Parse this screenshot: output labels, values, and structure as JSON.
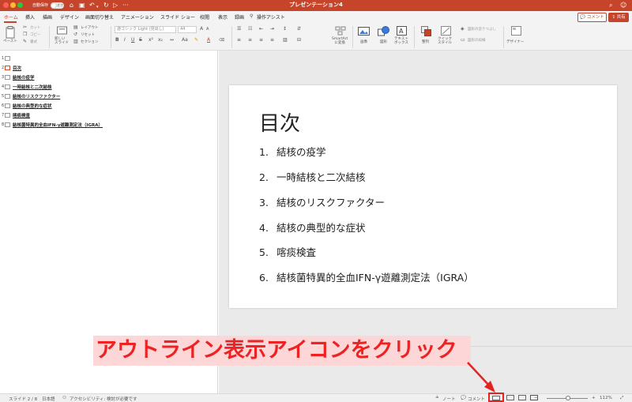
{
  "titlebar": {
    "title": "プレゼンテーション4",
    "autosave_label": "自動保存",
    "autosave_state": "オフ"
  },
  "menu": {
    "tabs": [
      "ホーム",
      "挿入",
      "描画",
      "デザイン",
      "画面切り替え",
      "アニメーション",
      "スライド ショー",
      "校閲",
      "表示",
      "録画",
      "操作アシスト"
    ],
    "active": "ホーム",
    "comment_button": "コメント",
    "share_button": "共有"
  },
  "ribbon": {
    "paste": "ペースト",
    "cut": "カット",
    "copy": "コピー",
    "format": "書式",
    "new_slide": "新しい\nスライド",
    "layout": "レイアウト",
    "reset": "リセット",
    "section": "セクション",
    "font_name": "游ゴシック Light (見出し)",
    "font_size": "44",
    "smartart": "SmartArt\nに変換",
    "picture": "画像",
    "shapes": "図形",
    "textbox": "テキスト\nボックス",
    "arrange": "整列",
    "quick_styles": "クイック\nスタイル",
    "shape_fill": "図形の塗りつぶし",
    "shape_outline": "図形の枠線",
    "designer": "デザイナー"
  },
  "outline": {
    "rows": [
      {
        "num": "1",
        "text": ""
      },
      {
        "num": "2",
        "text": "目次"
      },
      {
        "num": "3",
        "text": "結核の疫学"
      },
      {
        "num": "4",
        "text": "一時結核と二次結核"
      },
      {
        "num": "5",
        "text": "結核のリスクファクター"
      },
      {
        "num": "6",
        "text": "結核の典型的な症状"
      },
      {
        "num": "7",
        "text": "喀痰検査"
      },
      {
        "num": "8",
        "text": "結核菌特異的全血IFN-γ遊離測定法（IGRA）"
      }
    ]
  },
  "slide": {
    "title": "目次",
    "items": [
      {
        "num": "1.",
        "text": "結核の疫学"
      },
      {
        "num": "2.",
        "text": "一時結核と二次結核"
      },
      {
        "num": "3.",
        "text": "結核のリスクファクター"
      },
      {
        "num": "4.",
        "text": "結核の典型的な症状"
      },
      {
        "num": "5.",
        "text": "喀痰検査"
      },
      {
        "num": "6.",
        "text": "結核菌特異的全血IFN-γ遊離測定法（IGRA）"
      }
    ]
  },
  "annotation": {
    "text": "アウトライン表示アイコンをクリック",
    "color": "#ee2222",
    "background": "#fdd7d7"
  },
  "statusbar": {
    "slide_info": "スライド 2 / 8",
    "language": "日本語",
    "accessibility": "アクセシビリティ: 検討が必要です",
    "notes": "ノート",
    "comments": "コメント",
    "zoom": "112%"
  },
  "colors": {
    "accent": "#c6452a",
    "highlight_box": "#e52222"
  }
}
